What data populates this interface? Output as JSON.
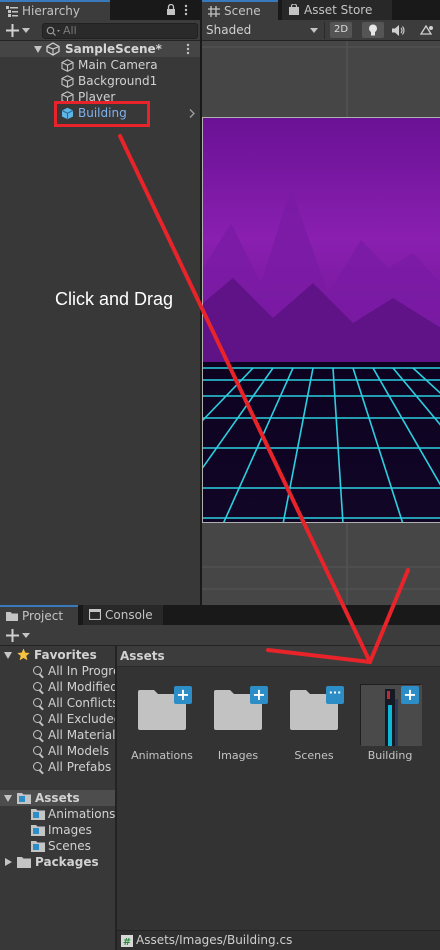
{
  "hierarchy": {
    "tab_label": "Hierarchy",
    "search_placeholder": "All",
    "scene_name": "SampleScene*",
    "items": [
      {
        "label": "Main Camera"
      },
      {
        "label": "Background1"
      },
      {
        "label": "Player"
      },
      {
        "label": "Building"
      }
    ]
  },
  "scene_view": {
    "tabs": [
      {
        "label": "Scene"
      },
      {
        "label": "Asset Store"
      }
    ],
    "shading_mode": "Shaded",
    "toggle_2d": "2D"
  },
  "annotation": {
    "text": "Click and Drag",
    "color": "#e8242a"
  },
  "project": {
    "tabs": [
      {
        "label": "Project"
      },
      {
        "label": "Console"
      }
    ],
    "favorites_label": "Favorites",
    "favorites": [
      {
        "label": "All In Progre"
      },
      {
        "label": "All Modified"
      },
      {
        "label": "All Conflicts"
      },
      {
        "label": "All Excluded"
      },
      {
        "label": "All Materials"
      },
      {
        "label": "All Models"
      },
      {
        "label": "All Prefabs"
      }
    ],
    "assets_label": "Assets",
    "asset_folders": [
      {
        "label": "Animations"
      },
      {
        "label": "Images"
      },
      {
        "label": "Scenes"
      }
    ],
    "packages_label": "Packages",
    "breadcrumb": "Assets",
    "grid_items": [
      {
        "label": "Animations",
        "badge": "+"
      },
      {
        "label": "Images",
        "badge": "+"
      },
      {
        "label": "Scenes",
        "badge": "···"
      },
      {
        "label": "Building",
        "badge": "+"
      }
    ],
    "status_path": "Assets/Images/Building.cs"
  },
  "colors": {
    "accent_blue": "#3a79bb",
    "selection_text": "#7eb2ee",
    "badge_blue": "#2d8ec7",
    "neon_cyan": "#2fe6f5",
    "sky_purple": "#8a1fb0"
  }
}
